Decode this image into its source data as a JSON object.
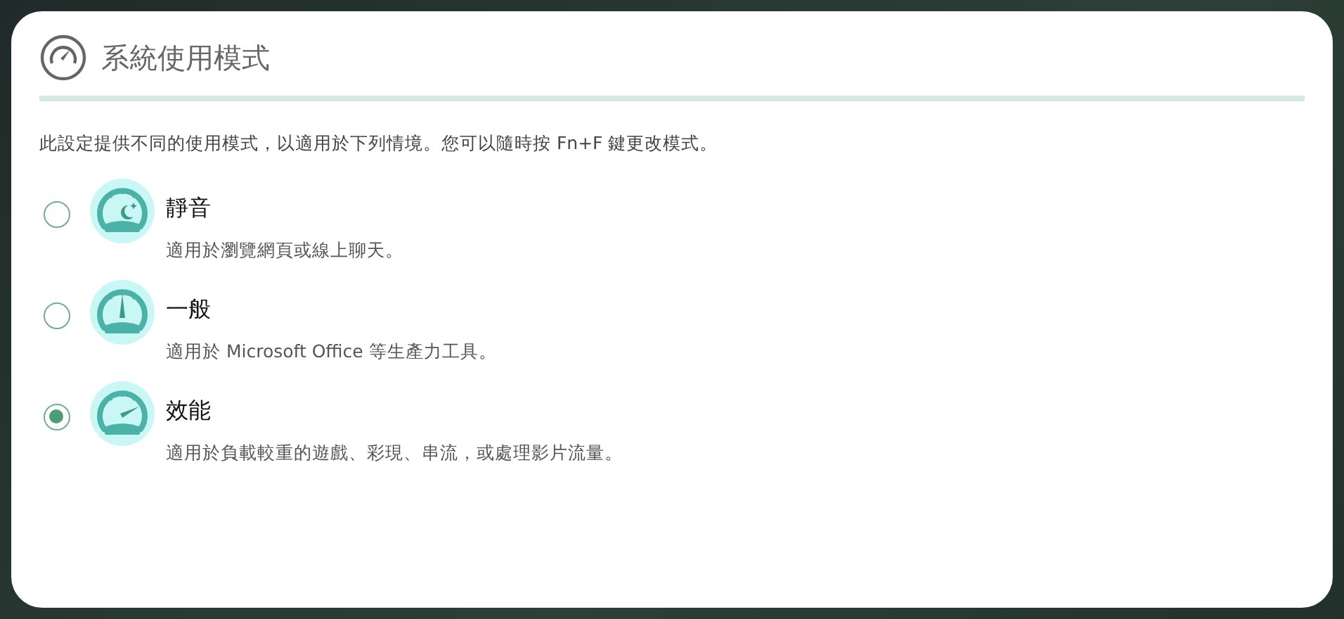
{
  "title": "系統使用模式",
  "description": "此設定提供不同的使用模式，以適用於下列情境。您可以隨時按 Fn+F 鍵更改模式。",
  "modes": [
    {
      "kind": "quiet",
      "name": "靜音",
      "detail": "適用於瀏覽網頁或線上聊天。",
      "selected": false
    },
    {
      "kind": "normal",
      "name": "一般",
      "detail": "適用於 Microsoft Office 等生產力工具。",
      "selected": false
    },
    {
      "kind": "performance",
      "name": "效能",
      "detail": "適用於負載較重的遊戲、彩現、串流，或處理影片流量。",
      "selected": true
    }
  ]
}
